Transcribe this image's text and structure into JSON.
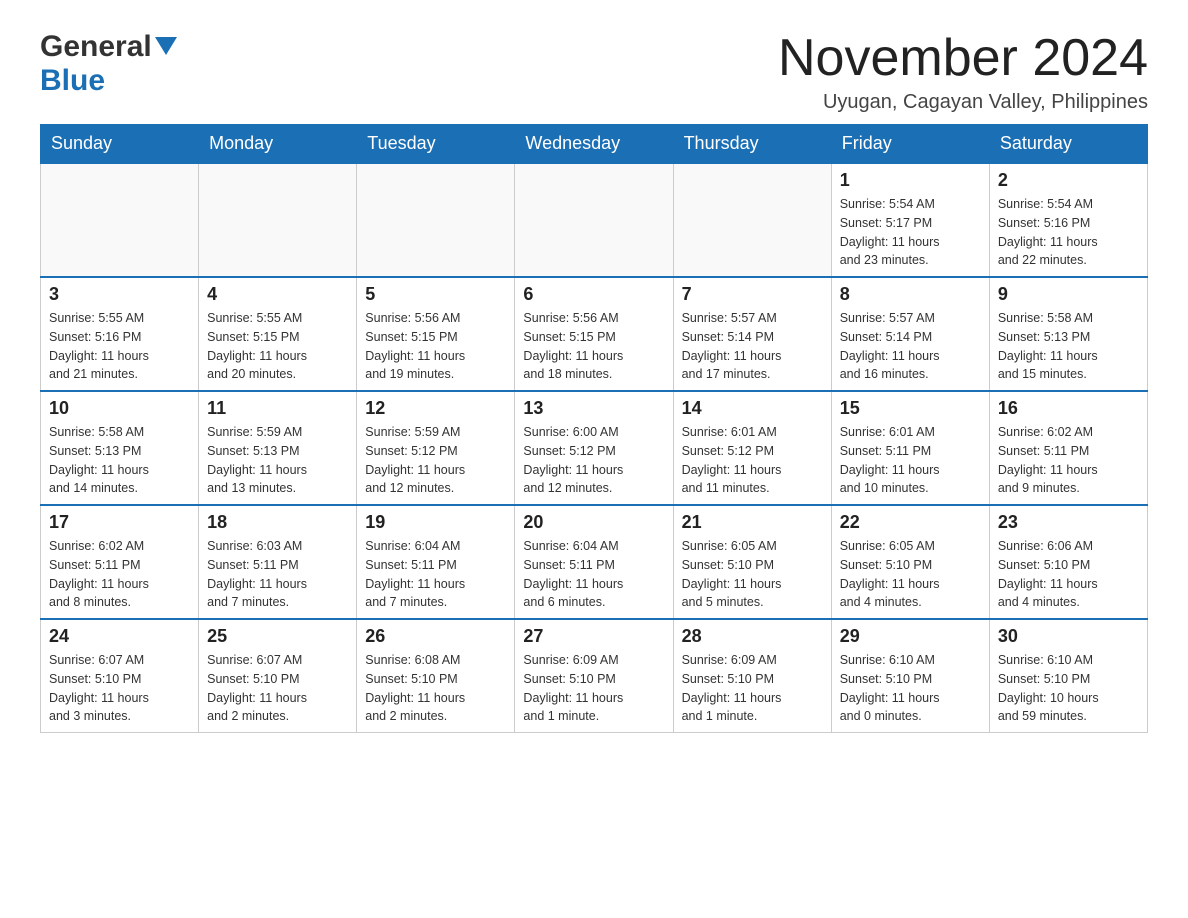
{
  "logo": {
    "general": "General",
    "blue": "Blue",
    "triangle_color": "#1a6fb5"
  },
  "title": "November 2024",
  "location": "Uyugan, Cagayan Valley, Philippines",
  "weekdays": [
    "Sunday",
    "Monday",
    "Tuesday",
    "Wednesday",
    "Thursday",
    "Friday",
    "Saturday"
  ],
  "weeks": [
    [
      {
        "day": "",
        "info": ""
      },
      {
        "day": "",
        "info": ""
      },
      {
        "day": "",
        "info": ""
      },
      {
        "day": "",
        "info": ""
      },
      {
        "day": "",
        "info": ""
      },
      {
        "day": "1",
        "info": "Sunrise: 5:54 AM\nSunset: 5:17 PM\nDaylight: 11 hours\nand 23 minutes."
      },
      {
        "day": "2",
        "info": "Sunrise: 5:54 AM\nSunset: 5:16 PM\nDaylight: 11 hours\nand 22 minutes."
      }
    ],
    [
      {
        "day": "3",
        "info": "Sunrise: 5:55 AM\nSunset: 5:16 PM\nDaylight: 11 hours\nand 21 minutes."
      },
      {
        "day": "4",
        "info": "Sunrise: 5:55 AM\nSunset: 5:15 PM\nDaylight: 11 hours\nand 20 minutes."
      },
      {
        "day": "5",
        "info": "Sunrise: 5:56 AM\nSunset: 5:15 PM\nDaylight: 11 hours\nand 19 minutes."
      },
      {
        "day": "6",
        "info": "Sunrise: 5:56 AM\nSunset: 5:15 PM\nDaylight: 11 hours\nand 18 minutes."
      },
      {
        "day": "7",
        "info": "Sunrise: 5:57 AM\nSunset: 5:14 PM\nDaylight: 11 hours\nand 17 minutes."
      },
      {
        "day": "8",
        "info": "Sunrise: 5:57 AM\nSunset: 5:14 PM\nDaylight: 11 hours\nand 16 minutes."
      },
      {
        "day": "9",
        "info": "Sunrise: 5:58 AM\nSunset: 5:13 PM\nDaylight: 11 hours\nand 15 minutes."
      }
    ],
    [
      {
        "day": "10",
        "info": "Sunrise: 5:58 AM\nSunset: 5:13 PM\nDaylight: 11 hours\nand 14 minutes."
      },
      {
        "day": "11",
        "info": "Sunrise: 5:59 AM\nSunset: 5:13 PM\nDaylight: 11 hours\nand 13 minutes."
      },
      {
        "day": "12",
        "info": "Sunrise: 5:59 AM\nSunset: 5:12 PM\nDaylight: 11 hours\nand 12 minutes."
      },
      {
        "day": "13",
        "info": "Sunrise: 6:00 AM\nSunset: 5:12 PM\nDaylight: 11 hours\nand 12 minutes."
      },
      {
        "day": "14",
        "info": "Sunrise: 6:01 AM\nSunset: 5:12 PM\nDaylight: 11 hours\nand 11 minutes."
      },
      {
        "day": "15",
        "info": "Sunrise: 6:01 AM\nSunset: 5:11 PM\nDaylight: 11 hours\nand 10 minutes."
      },
      {
        "day": "16",
        "info": "Sunrise: 6:02 AM\nSunset: 5:11 PM\nDaylight: 11 hours\nand 9 minutes."
      }
    ],
    [
      {
        "day": "17",
        "info": "Sunrise: 6:02 AM\nSunset: 5:11 PM\nDaylight: 11 hours\nand 8 minutes."
      },
      {
        "day": "18",
        "info": "Sunrise: 6:03 AM\nSunset: 5:11 PM\nDaylight: 11 hours\nand 7 minutes."
      },
      {
        "day": "19",
        "info": "Sunrise: 6:04 AM\nSunset: 5:11 PM\nDaylight: 11 hours\nand 7 minutes."
      },
      {
        "day": "20",
        "info": "Sunrise: 6:04 AM\nSunset: 5:11 PM\nDaylight: 11 hours\nand 6 minutes."
      },
      {
        "day": "21",
        "info": "Sunrise: 6:05 AM\nSunset: 5:10 PM\nDaylight: 11 hours\nand 5 minutes."
      },
      {
        "day": "22",
        "info": "Sunrise: 6:05 AM\nSunset: 5:10 PM\nDaylight: 11 hours\nand 4 minutes."
      },
      {
        "day": "23",
        "info": "Sunrise: 6:06 AM\nSunset: 5:10 PM\nDaylight: 11 hours\nand 4 minutes."
      }
    ],
    [
      {
        "day": "24",
        "info": "Sunrise: 6:07 AM\nSunset: 5:10 PM\nDaylight: 11 hours\nand 3 minutes."
      },
      {
        "day": "25",
        "info": "Sunrise: 6:07 AM\nSunset: 5:10 PM\nDaylight: 11 hours\nand 2 minutes."
      },
      {
        "day": "26",
        "info": "Sunrise: 6:08 AM\nSunset: 5:10 PM\nDaylight: 11 hours\nand 2 minutes."
      },
      {
        "day": "27",
        "info": "Sunrise: 6:09 AM\nSunset: 5:10 PM\nDaylight: 11 hours\nand 1 minute."
      },
      {
        "day": "28",
        "info": "Sunrise: 6:09 AM\nSunset: 5:10 PM\nDaylight: 11 hours\nand 1 minute."
      },
      {
        "day": "29",
        "info": "Sunrise: 6:10 AM\nSunset: 5:10 PM\nDaylight: 11 hours\nand 0 minutes."
      },
      {
        "day": "30",
        "info": "Sunrise: 6:10 AM\nSunset: 5:10 PM\nDaylight: 10 hours\nand 59 minutes."
      }
    ]
  ]
}
